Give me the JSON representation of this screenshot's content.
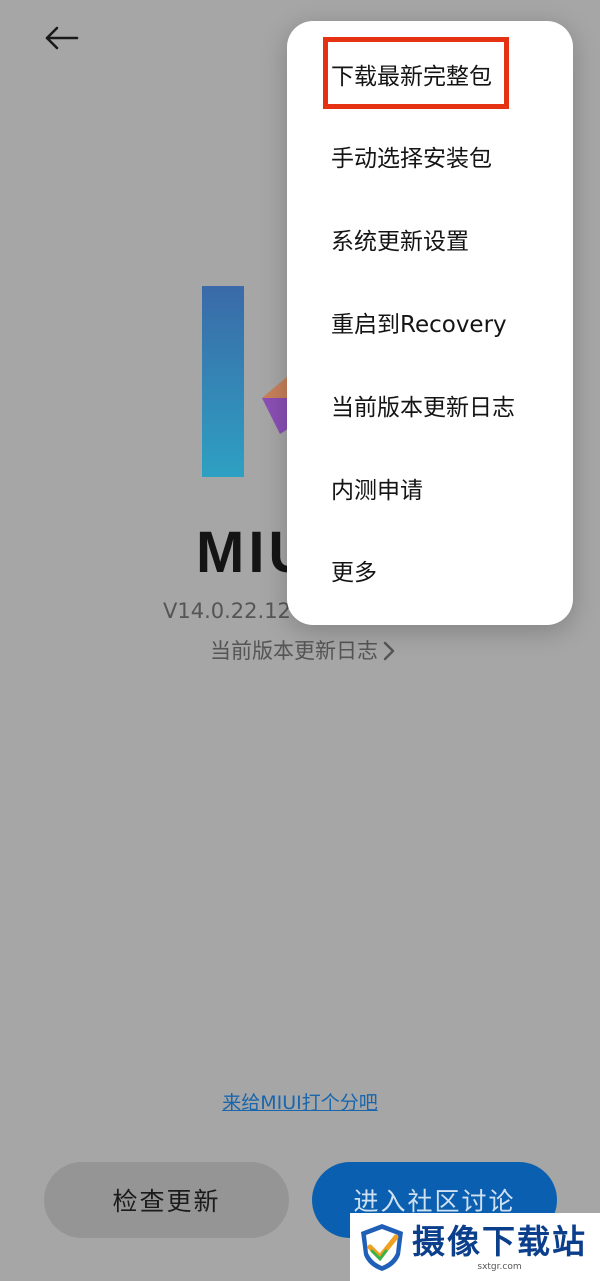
{
  "header": {
    "back_icon": "arrow-left-icon"
  },
  "brand": {
    "logo_text": "MIUI",
    "version": "V14.0.22.12.",
    "changelog_link": "当前版本更新日志",
    "logo_colors": [
      "#3a6aa8",
      "#2ea0c2",
      "#c7805a",
      "#8a4fb5"
    ]
  },
  "footer": {
    "rate_link": "来给MIUI打个分吧",
    "check_update_button": "检查更新",
    "community_button": "进入社区讨论"
  },
  "menu": {
    "items": [
      {
        "label": "下载最新完整包",
        "highlighted": true
      },
      {
        "label": "手动选择安装包"
      },
      {
        "label": "系统更新设置"
      },
      {
        "label": "重启到Recovery"
      },
      {
        "label": "当前版本更新日志"
      },
      {
        "label": "内测申请"
      },
      {
        "label": "更多"
      }
    ]
  },
  "watermark": {
    "title": "摄像下载站",
    "subtitle": "sxtgr.com"
  },
  "colors": {
    "highlight_border": "#e53212",
    "link": "#1a66ad",
    "primary_button": "#0b5fb0",
    "secondary_button": "#959595"
  }
}
